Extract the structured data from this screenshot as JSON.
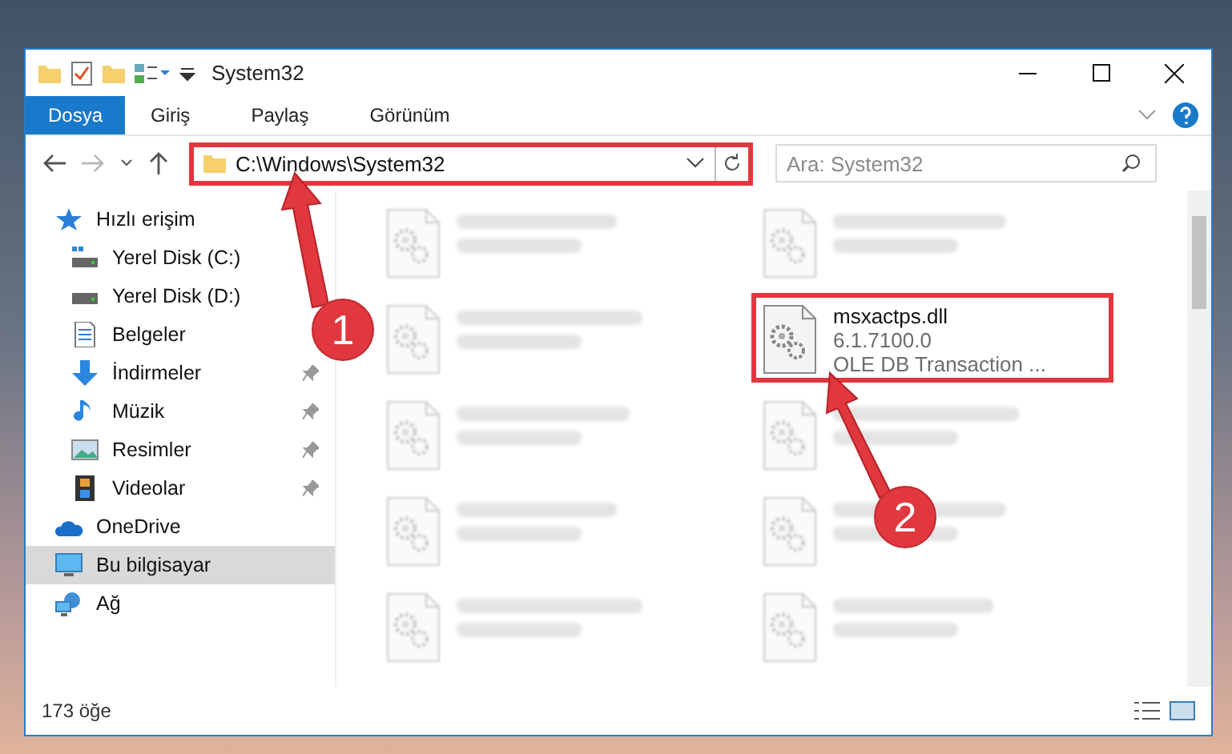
{
  "window": {
    "title": "System32"
  },
  "ribbon_tabs": [
    {
      "label": "Dosya",
      "selected": true
    },
    {
      "label": "Giriş",
      "selected": false
    },
    {
      "label": "Paylaş",
      "selected": false
    },
    {
      "label": "Görünüm",
      "selected": false
    }
  ],
  "address": {
    "path": "C:\\Windows\\System32",
    "highlighted": true
  },
  "search": {
    "placeholder": "Ara: System32"
  },
  "sidebar": {
    "items": [
      {
        "label": "Hızlı erişim",
        "kind": "star",
        "selected": false,
        "children": [
          {
            "label": "Yerel Disk (C:)",
            "kind": "drive-c",
            "pinned": false,
            "selected": false
          },
          {
            "label": "Yerel Disk (D:)",
            "kind": "drive",
            "pinned": false,
            "selected": false
          },
          {
            "label": "Belgeler",
            "kind": "documents",
            "pinned": false,
            "selected": false
          },
          {
            "label": "İndirmeler",
            "kind": "downloads",
            "pinned": true,
            "selected": false
          },
          {
            "label": "Müzik",
            "kind": "music",
            "pinned": true,
            "selected": false
          },
          {
            "label": "Resimler",
            "kind": "pictures",
            "pinned": true,
            "selected": false
          },
          {
            "label": "Videolar",
            "kind": "videos",
            "pinned": true,
            "selected": false
          }
        ]
      },
      {
        "label": "OneDrive",
        "kind": "cloud",
        "selected": false
      },
      {
        "label": "Bu bilgisayar",
        "kind": "computer",
        "selected": true
      },
      {
        "label": "Ağ",
        "kind": "network",
        "selected": false
      }
    ]
  },
  "files": [
    {
      "kind": "blurred"
    },
    {
      "kind": "blurred"
    },
    {
      "kind": "blurred"
    },
    {
      "kind": "file",
      "name": "msxactps.dll",
      "details": [
        "6.1.7100.0",
        "OLE DB Transaction ..."
      ],
      "highlighted": true
    },
    {
      "kind": "blurred"
    },
    {
      "kind": "blurred"
    },
    {
      "kind": "blurred"
    },
    {
      "kind": "blurred"
    },
    {
      "kind": "blurred"
    },
    {
      "kind": "blurred"
    }
  ],
  "status_bar": {
    "item_count": "173 öğe"
  },
  "callouts": [
    {
      "label": "1"
    },
    {
      "label": "2"
    }
  ]
}
